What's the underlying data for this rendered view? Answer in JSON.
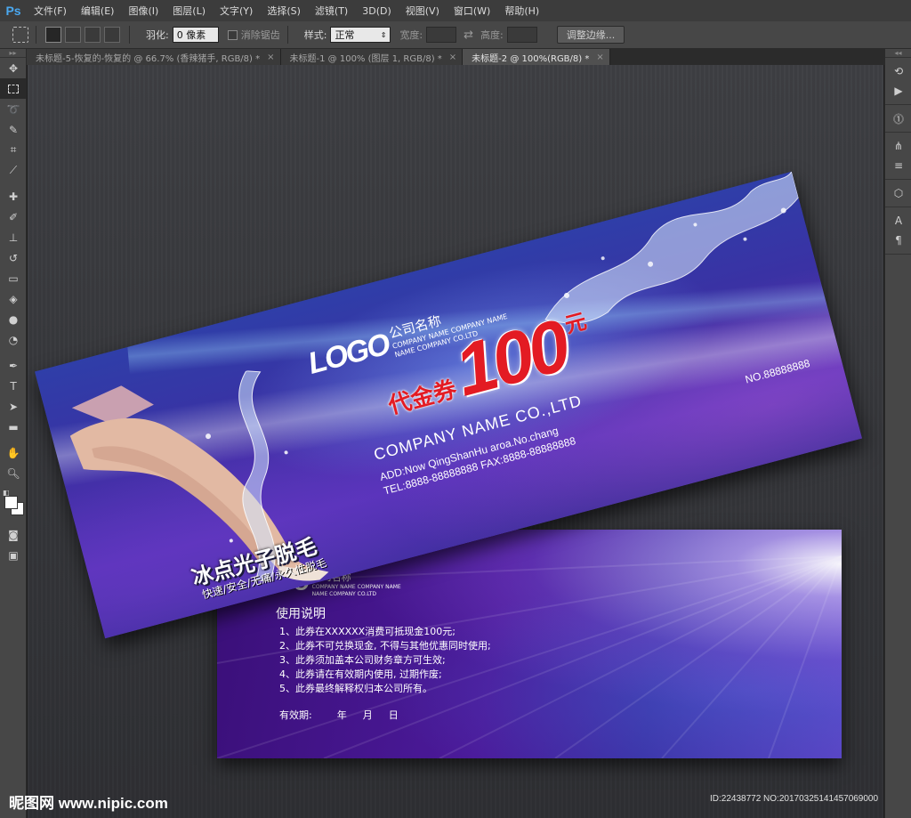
{
  "app": {
    "logo": "Ps"
  },
  "menu": [
    "文件(F)",
    "编辑(E)",
    "图像(I)",
    "图层(L)",
    "文字(Y)",
    "选择(S)",
    "滤镜(T)",
    "3D(D)",
    "视图(V)",
    "窗口(W)",
    "帮助(H)"
  ],
  "options": {
    "feather_label": "羽化:",
    "feather_value": "0 像素",
    "antialias_label": "消除锯齿",
    "style_label": "样式:",
    "style_value": "正常",
    "width_label": "宽度:",
    "height_label": "高度:",
    "refine_edge_button": "调整边缘..."
  },
  "tabs": [
    {
      "label": "未标题-5-恢复的-恢复的 @ 66.7% (香辣猪手, RGB/8) *",
      "close": "×"
    },
    {
      "label": "未标题-1 @ 100% (图层 1, RGB/8) *",
      "close": "×"
    },
    {
      "label": "未标题-2 @ 100%(RGB/8) *",
      "close": "×"
    }
  ],
  "coupon_front": {
    "logo": "LOGO",
    "company_cn": "公司名称",
    "company_en_1": "COMPANY NAME COMPANY NAME",
    "company_en_2": "NAME COMPANY CO.LTD",
    "coupon_label": "代金券",
    "amount": "100",
    "unit": "元",
    "company_name_big": "COMPANY NAME CO.,LTD",
    "address": "ADD:Now QingShanHu aroa.No.chang",
    "tel_fax": "TEL:8888-88888888   FAX:8888-88888888",
    "serial": "NO.88888888",
    "slogan": "冰点光子脱毛",
    "slogan_sub": "快速/安全/无痛/永久性脱毛"
  },
  "coupon_back": {
    "logo": "LOGO",
    "company_cn": "公司名称",
    "company_en_1": "COMPANY NAME COMPANY NAME",
    "company_en_2": "NAME COMPANY CO.LTD",
    "usage_title": "使用说明",
    "rules": [
      "1、此券在XXXXXX消费可抵现金100元;",
      "2、此券不可兑换现金, 不得与其他优惠同时使用;",
      "3、此券须加盖本公司财务章方可生效;",
      "4、此券请在有效期内使用, 过期作废;",
      "5、此券最终解释权归本公司所有。"
    ],
    "validity_label": "有效期:",
    "year": "年",
    "month": "月",
    "day": "日"
  },
  "watermark": {
    "left": "昵图网 www.nipic.com",
    "right": "ID:22438772 NO:20170325141457069000"
  }
}
